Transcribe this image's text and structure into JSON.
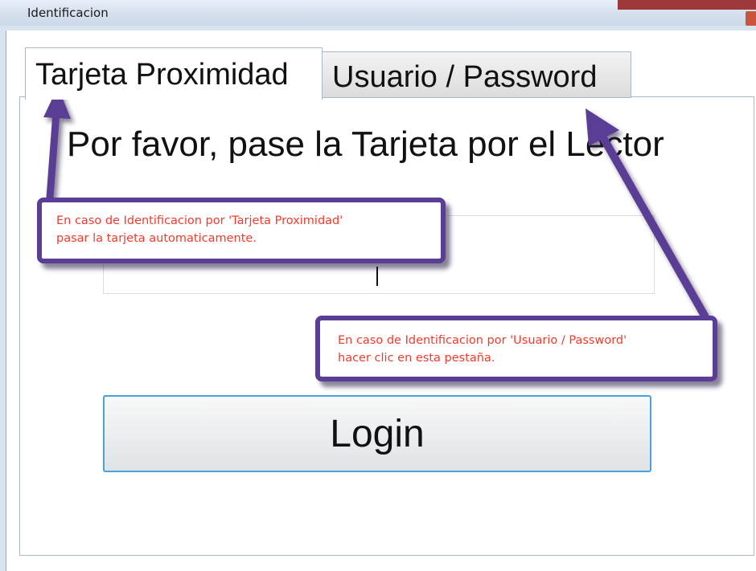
{
  "window": {
    "title": "Identificacion"
  },
  "tabs": [
    {
      "label": "Tarjeta Proximidad",
      "active": true
    },
    {
      "label": "Usuario / Password",
      "active": false
    }
  ],
  "main": {
    "prompt": "Por favor, pase la Tarjeta por el Lector",
    "card_input_value": "",
    "login_label": "Login"
  },
  "callouts": {
    "card": {
      "line1": "En caso de Identificacion por 'Tarjeta Proximidad'",
      "line2": "pasar la tarjeta automaticamente."
    },
    "user": {
      "line1": "En caso de Identificacion por 'Usuario / Password'",
      "line2": "hacer clic en esta pestaña."
    }
  },
  "colors": {
    "callout_border": "#5a3d94",
    "callout_text": "#f03a2a",
    "login_border": "#4aa3d8"
  },
  "icons": {
    "close": "close-icon",
    "arrow": "arrow-icon"
  }
}
